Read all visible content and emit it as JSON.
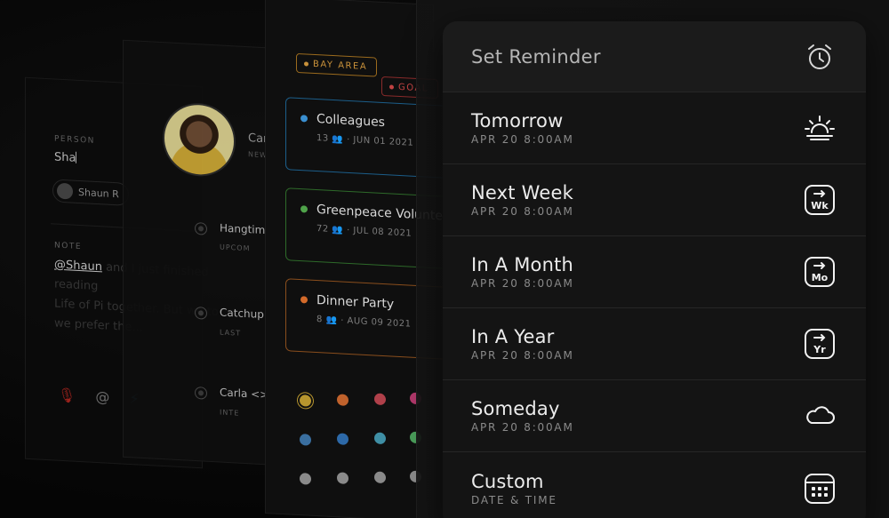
{
  "person_card": {
    "person_label": "PERSON",
    "person_input_value": "Sha",
    "chip_name": "Shaun R",
    "note_label": "NOTE",
    "note_mention": "@Shaun",
    "note_text_1": " and I just finished reading",
    "note_text_2": "Life of Pi together. But we to",
    "note_text_3": "we prefer the..."
  },
  "contact_card": {
    "name": "Carla S",
    "sub": "NEW",
    "items": [
      {
        "label": "Hangtime",
        "sub": "UPCOM"
      },
      {
        "label": "Catchup",
        "sub": "LAST"
      },
      {
        "label": "Carla <>",
        "sub": "INTE"
      }
    ]
  },
  "groups_card": {
    "tags": [
      "BAY AREA",
      "GOAL"
    ],
    "groups": [
      {
        "name": "Colleagues",
        "count": "13",
        "date": "· JUN 01 2021",
        "color": "#3a8fd0"
      },
      {
        "name": "Greenpeace Volunteers",
        "count": "72",
        "date": "· JUL 08 2021",
        "color": "#4fa34a"
      },
      {
        "name": "Dinner Party",
        "count": "8",
        "date": "· AUG 09 2021",
        "color": "#d36a2a"
      }
    ],
    "swatches": [
      "#b8962e",
      "#c0622c",
      "#b0404a",
      "#b0386a",
      "#3a6fa0",
      "#2d69a8",
      "#3f8fa5",
      "#4a9d5a",
      "#8a8a8a",
      "#8a8a8a",
      "#8a8a8a",
      "#8a8a8a"
    ]
  },
  "reminder": {
    "title": "Set Reminder",
    "title_icon": "alarm-clock-icon",
    "options": [
      {
        "label": "Tomorrow",
        "sub": "APR 20 8:00AM",
        "icon": "sunrise-icon"
      },
      {
        "label": "Next Week",
        "sub": "APR 20 8:00AM",
        "icon": "week-icon",
        "badge": "Wk"
      },
      {
        "label": "In A Month",
        "sub": "APR 20 8:00AM",
        "icon": "month-icon",
        "badge": "Mo"
      },
      {
        "label": "In A Year",
        "sub": "APR 20 8:00AM",
        "icon": "year-icon",
        "badge": "Yr"
      },
      {
        "label": "Someday",
        "sub": "APR 20 8:00AM",
        "icon": "cloud-icon"
      },
      {
        "label": "Custom",
        "sub": "DATE & TIME",
        "icon": "calendar-icon"
      }
    ]
  }
}
